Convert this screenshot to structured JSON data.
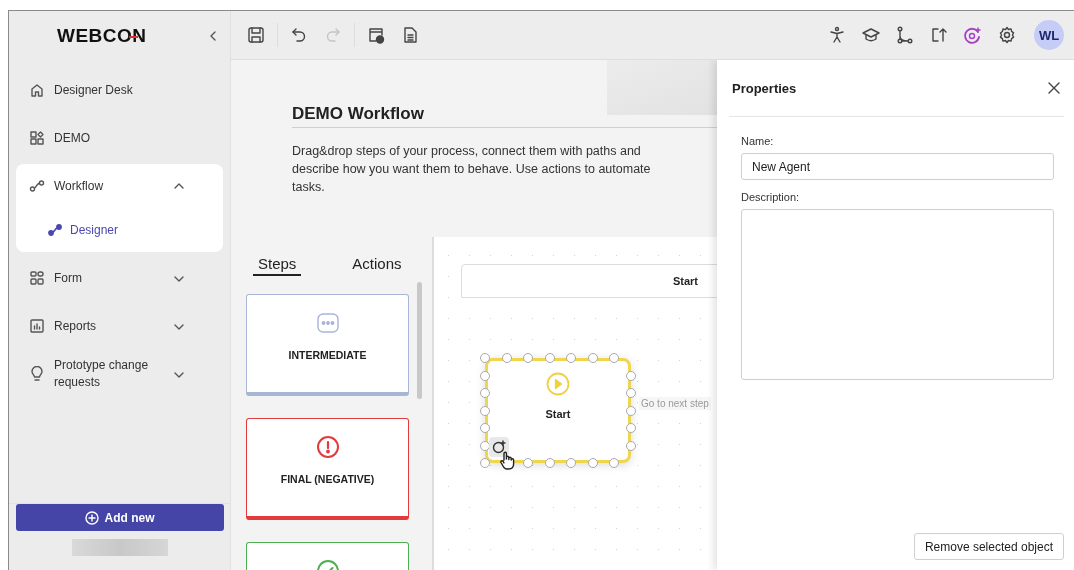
{
  "logo": {
    "text": "WEBCON"
  },
  "sidebar": {
    "items": [
      {
        "label": "Designer Desk",
        "selected": false
      },
      {
        "label": "DEMO",
        "selected": false
      },
      {
        "label": "Workflow",
        "selected": true,
        "expanded": true,
        "children": [
          {
            "label": "Designer",
            "selected": true
          }
        ]
      },
      {
        "label": "Form",
        "selected": false,
        "expanded": false
      },
      {
        "label": "Reports",
        "selected": false,
        "expanded": false
      },
      {
        "label": "Prototype change requests",
        "selected": false,
        "expanded": false
      }
    ],
    "add_button": "Add new"
  },
  "toolbar": {
    "left_tools": [
      {
        "disabled": false
      },
      {
        "disabled": false
      },
      {
        "disabled": true
      },
      {
        "disabled": false
      },
      {
        "disabled": false
      }
    ],
    "avatar": "WL"
  },
  "header": {
    "title": "DEMO Workflow",
    "description": "Drag&drop steps of your process, connect them with paths and describe how you want them to behave. Use actions to automate tasks."
  },
  "panel_tabs": [
    {
      "label": "Steps",
      "selected": true
    },
    {
      "label": "Actions",
      "selected": false
    }
  ],
  "step_types": [
    {
      "kind": "intermediate",
      "label": "INTERMEDIATE"
    },
    {
      "kind": "negative",
      "label": "FINAL (NEGATIVE)"
    },
    {
      "kind": "positive"
    }
  ],
  "canvas": {
    "lane": "Start",
    "node": {
      "label": "Start",
      "selected": true
    },
    "path_hint": "Go to next step"
  },
  "properties": {
    "title": "Properties",
    "fields": [
      {
        "kind": "text",
        "label": "Name:",
        "value": "New Agent"
      },
      {
        "kind": "textarea",
        "label": "Description:"
      }
    ],
    "remove_button": "Remove selected object"
  }
}
